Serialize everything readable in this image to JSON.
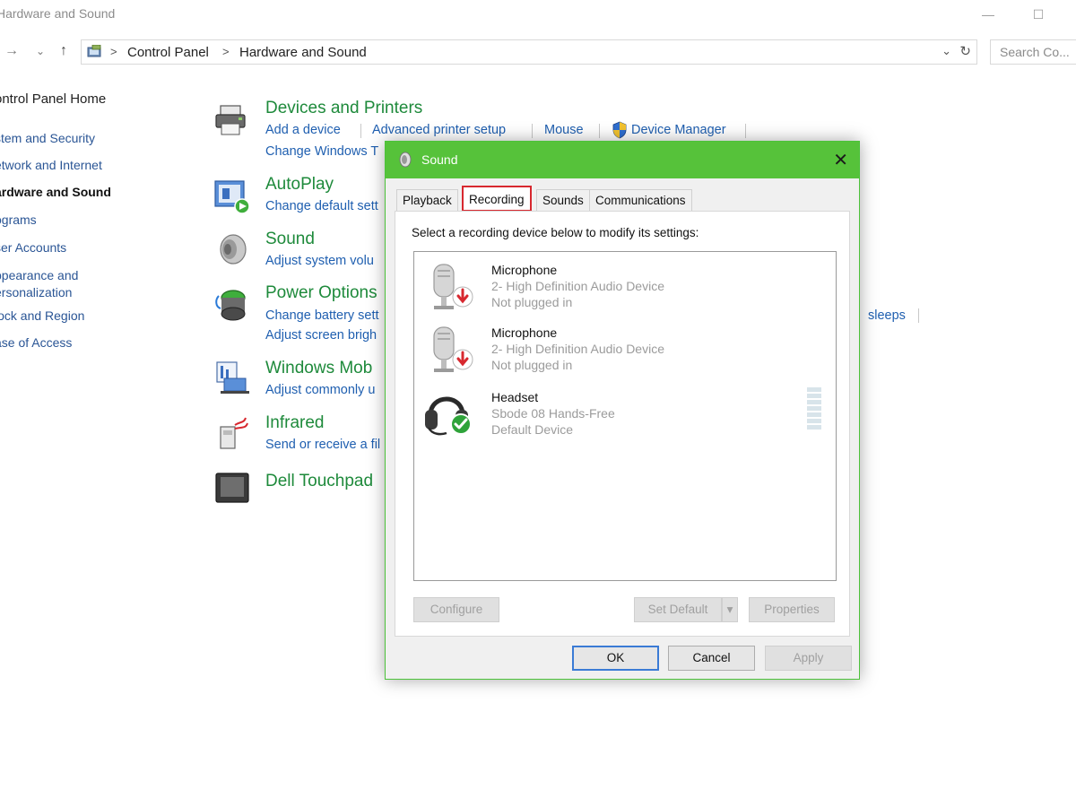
{
  "window": {
    "title": "Hardware and Sound",
    "minimize_glyph": "—",
    "maximize_glyph": "☐"
  },
  "address_bar": {
    "back_glyph": "→",
    "dropdown_glyph": "⌄",
    "up_glyph": "↑",
    "breadcrumbs": [
      "Control Panel",
      "Hardware and Sound"
    ],
    "separator": ">",
    "refresh_glyph": "↻",
    "chevron_glyph": "⌄",
    "search_placeholder": "Search Co..."
  },
  "left_nav": {
    "home": "ontrol Panel Home",
    "items": [
      {
        "label": "stem and Security",
        "active": false
      },
      {
        "label": "etwork and Internet",
        "active": false
      },
      {
        "label": "ardware and Sound",
        "active": true
      },
      {
        "label": "ograms",
        "active": false
      },
      {
        "label": "ser Accounts",
        "active": false
      },
      {
        "label": "ppearance and",
        "active": false
      },
      {
        "label": "ersonalization",
        "active": false
      },
      {
        "label": "lock and Region",
        "active": false
      },
      {
        "label": "ase of Access",
        "active": false
      }
    ]
  },
  "categories": [
    {
      "title": "Devices and Printers",
      "icon": "printer-icon",
      "links": [
        "Add a device",
        "Advanced printer setup",
        "Mouse",
        "Device Manager",
        "Change Windows T"
      ]
    },
    {
      "title": "AutoPlay",
      "icon": "autoplay-icon",
      "links": [
        "Change default sett"
      ]
    },
    {
      "title": "Sound",
      "icon": "speaker-icon",
      "links": [
        "Adjust system volu"
      ]
    },
    {
      "title": "Power Options",
      "icon": "battery-icon",
      "links": [
        "Change battery sett",
        "Adjust screen brigh",
        "sleeps"
      ]
    },
    {
      "title": "Windows Mob",
      "icon": "mobility-icon",
      "links": [
        "Adjust commonly u"
      ]
    },
    {
      "title": "Infrared",
      "icon": "infrared-icon",
      "links": [
        "Send or receive a fil"
      ]
    },
    {
      "title": "Dell Touchpad",
      "icon": "touchpad-icon",
      "links": []
    }
  ],
  "dialog": {
    "title": "Sound",
    "close_glyph": "✕",
    "tabs": [
      {
        "label": "Playback",
        "active": false
      },
      {
        "label": "Recording",
        "active": true
      },
      {
        "label": "Sounds",
        "active": false
      },
      {
        "label": "Communications",
        "active": false
      }
    ],
    "instruction": "Select a recording device below to modify its settings:",
    "devices": [
      {
        "name": "Microphone",
        "driver": "2- High Definition Audio Device",
        "status": "Not plugged in",
        "icon": "microphone-icon",
        "badge": "unplugged-arrow-icon"
      },
      {
        "name": "Microphone",
        "driver": "2- High Definition Audio Device",
        "status": "Not plugged in",
        "icon": "microphone-icon",
        "badge": "unplugged-arrow-icon"
      },
      {
        "name": "Headset",
        "driver": "Sbode 08 Hands-Free",
        "status": "Default Device",
        "icon": "headset-icon",
        "badge": "checkmark-icon"
      }
    ],
    "buttons": {
      "configure": "Configure",
      "set_default": "Set Default",
      "set_default_arrow": "▾",
      "properties": "Properties",
      "ok": "OK",
      "cancel": "Cancel",
      "apply": "Apply"
    }
  },
  "colors": {
    "category_title": "#1e8a3b",
    "link": "#1f5fb0",
    "dialog_titlebar": "#56c23a",
    "active_tab_outline": "#d7282f"
  }
}
